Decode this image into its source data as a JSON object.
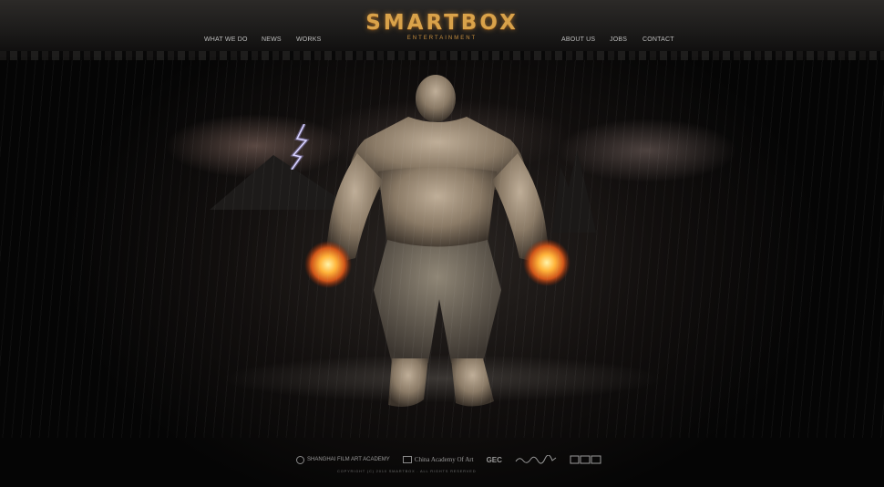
{
  "brand": {
    "logo_text": "SMARTBOX",
    "logo_subtitle": "ENTERTAINMENT",
    "logo_color": "#d9a24a"
  },
  "nav": {
    "left": [
      "WHAT WE DO",
      "NEWS",
      "WORKS"
    ],
    "right": [
      "ABOUT US",
      "JOBS",
      "CONTACT"
    ]
  },
  "hero": {
    "icons": [
      "lightning-icon",
      "monster-character-art"
    ]
  },
  "footer": {
    "partners": [
      "SHANGHAI FILM ART ACADEMY",
      "China Academy Of Art",
      "GEC"
    ],
    "copyright": "COPYRIGHT (C) 2010 SMARTBOX . ALL RIGHTS RESERVED"
  }
}
